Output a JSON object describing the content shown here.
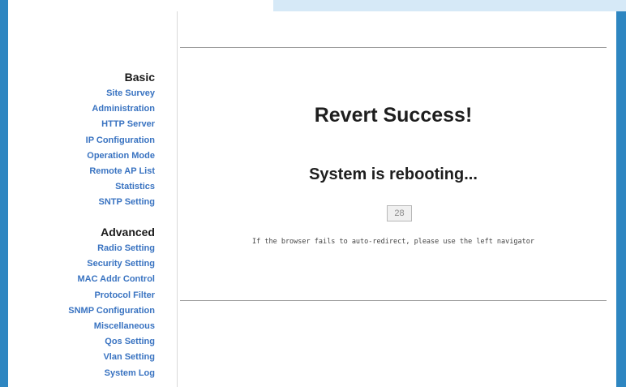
{
  "nav": {
    "basic": {
      "heading": "Basic",
      "items": [
        "Site Survey",
        "Administration",
        "HTTP Server",
        "IP Configuration",
        "Operation Mode",
        "Remote AP List",
        "Statistics",
        "SNTP Setting"
      ]
    },
    "advanced": {
      "heading": "Advanced",
      "items": [
        "Radio Setting",
        "Security Setting",
        "MAC Addr Control",
        "Protocol Filter",
        "SNMP Configuration",
        "Miscellaneous",
        "Qos Setting",
        "Vlan Setting",
        "System Log"
      ]
    }
  },
  "main": {
    "title": "Revert Success!",
    "subtitle": "System is rebooting...",
    "countdown": "28",
    "hint": "If the browser fails to auto-redirect, please use the left navigator"
  },
  "colors": {
    "link": "#3973c1",
    "border": "#2e86c1"
  }
}
